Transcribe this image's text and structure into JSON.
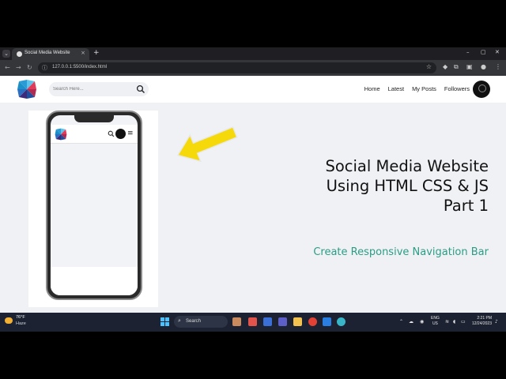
{
  "browser": {
    "tab_title": "Social Media Website",
    "tab_close": "×",
    "new_tab": "+",
    "url": "127.0.0.1:5500/index.html",
    "window_controls": [
      "–",
      "▢",
      "✕"
    ]
  },
  "site": {
    "search_placeholder": "Search Here...",
    "nav": [
      "Home",
      "Latest",
      "My Posts",
      "Followers"
    ],
    "logo_colors": [
      "#2b9bd6",
      "#e23b5a",
      "#1f4e9c",
      "#3d2a7a"
    ]
  },
  "promo": {
    "headline": [
      "Social Media Website",
      "Using HTML CSS & JS",
      "Part 1"
    ],
    "subheading": "Create Responsive Navigation Bar",
    "accent_color": "#2a9d86",
    "arrow_color": "#f5d90a",
    "mobile_menu_icon": "≡"
  },
  "taskbar": {
    "weather_temp": "76°F",
    "weather_condition": "Haze",
    "search_label": "Search",
    "language": [
      "ENG",
      "US"
    ],
    "time": "2:21 PM",
    "date": "12/24/2023"
  }
}
